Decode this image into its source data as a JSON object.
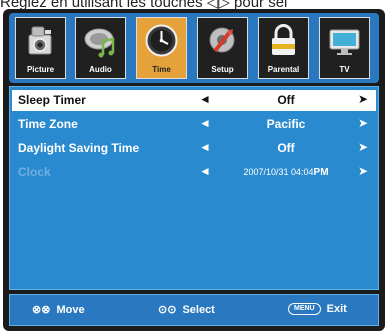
{
  "top_caption": "Réglez en utilisant les touches  ◁▷  pour sél",
  "tabs": [
    {
      "label": "Picture",
      "icon": "picture-icon",
      "active": false
    },
    {
      "label": "Audio",
      "icon": "audio-icon",
      "active": false
    },
    {
      "label": "Time",
      "icon": "clock-icon",
      "active": true
    },
    {
      "label": "Setup",
      "icon": "setup-icon",
      "active": false
    },
    {
      "label": "Parental",
      "icon": "lock-icon",
      "active": false
    },
    {
      "label": "TV",
      "icon": "tv-icon",
      "active": false
    }
  ],
  "menu": {
    "rows": [
      {
        "label": "Sleep Timer",
        "value": "Off",
        "left_arrow": "◄",
        "right_arrow": "➤",
        "selected": true,
        "disabled": false
      },
      {
        "label": "Time Zone",
        "value": "Pacific",
        "left_arrow": "◄",
        "right_arrow": "➤",
        "selected": false,
        "disabled": false
      },
      {
        "label": "Daylight Saving Time",
        "value": "Off",
        "left_arrow": "◄",
        "right_arrow": "➤",
        "selected": false,
        "disabled": false
      },
      {
        "label": "Clock",
        "value": "2007/10/31 04:04",
        "value_suffix": "PM",
        "left_arrow": "◄",
        "right_arrow": "➤",
        "selected": false,
        "disabled": true
      }
    ]
  },
  "footer": {
    "move_keys": "⊗⊗",
    "move_label": "Move",
    "select_keys": "⊙⊙",
    "select_label": "Select",
    "menu_key": "MENU",
    "exit_label": "Exit"
  },
  "colors": {
    "panel_blue": "#2a8ad0",
    "bar_blue": "#2a78bf",
    "active_tab": "#e6a23a",
    "frame": "#1b1b1b"
  }
}
